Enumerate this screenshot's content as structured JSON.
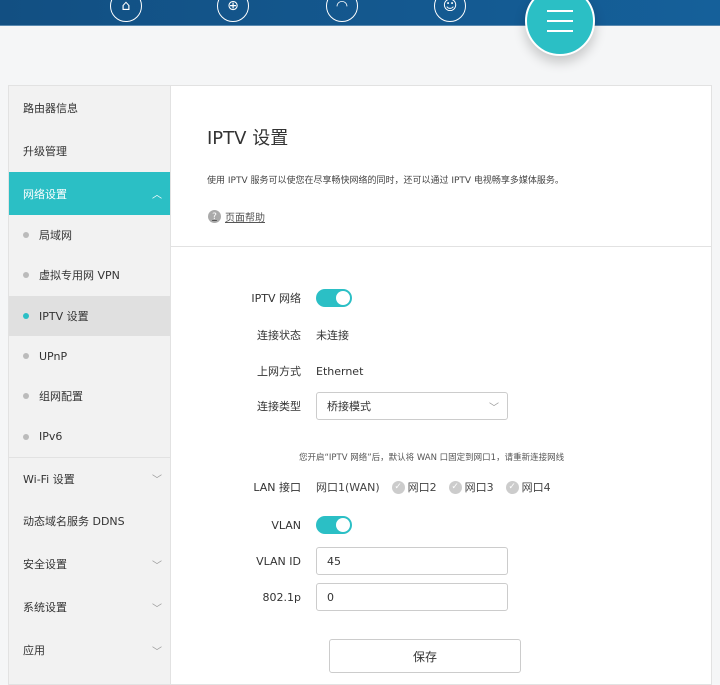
{
  "topnav": {
    "icons": [
      "home-icon",
      "globe-icon",
      "wifi-icon",
      "user-icon"
    ],
    "menu": "menu-icon"
  },
  "sidebar": {
    "items": [
      {
        "label": "路由器信息"
      },
      {
        "label": "升级管理"
      },
      {
        "label": "网络设置"
      },
      {
        "label": "局域网"
      },
      {
        "label": "虚拟专用网 VPN"
      },
      {
        "label": "IPTV 设置"
      },
      {
        "label": "UPnP"
      },
      {
        "label": "组网配置"
      },
      {
        "label": "IPv6"
      },
      {
        "label": "Wi-Fi 设置"
      },
      {
        "label": "动态域名服务 DDNS"
      },
      {
        "label": "安全设置"
      },
      {
        "label": "系统设置"
      },
      {
        "label": "应用"
      }
    ]
  },
  "page": {
    "title": "IPTV 设置",
    "desc": "使用 IPTV 服务可以使您在尽享畅快网络的同时，还可以通过 IPTV 电视畅享多媒体服务。",
    "help": "页面帮助"
  },
  "form": {
    "iptv_label": "IPTV 网络",
    "iptv_on": true,
    "status_label": "连接状态",
    "status_value": "未连接",
    "mode_label": "上网方式",
    "mode_value": "Ethernet",
    "type_label": "连接类型",
    "type_value": "桥接模式",
    "note": "您开启“IPTV 网络”后，默认将 WAN 口固定到网口1，请重新连接网线",
    "lan_label": "LAN 接口",
    "wan_port": "网口1(WAN)",
    "ports": [
      "网口2",
      "网口3",
      "网口4"
    ],
    "vlan_label": "VLAN",
    "vlan_on": true,
    "vlanid_label": "VLAN ID",
    "vlanid_value": "45",
    "p_label": "802.1p",
    "p_value": "0",
    "save": "保存"
  },
  "colors": {
    "accent": "#2bbfc5",
    "header": "#13558a"
  }
}
